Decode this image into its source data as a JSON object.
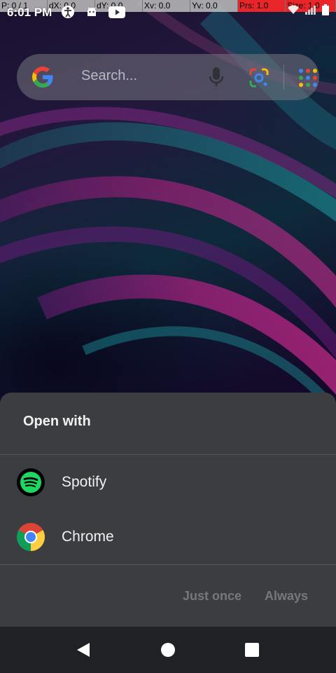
{
  "debug_overlay": {
    "pointer": "P: 0 / 1",
    "dx": "dX: 0.0",
    "dy": "dY: 0.0",
    "xv": "Xv: 0.0",
    "yv": "Yv: 0.0",
    "prs": "Prs: 1.0",
    "size": "Size: 1.0"
  },
  "status_bar": {
    "time": "6:01 PM",
    "icons": [
      "accessibility-icon",
      "android-debug-icon",
      "youtube-icon"
    ],
    "right_icons": [
      "wifi-icon",
      "signal-icon",
      "battery-icon"
    ]
  },
  "search_widget": {
    "placeholder": "Search..."
  },
  "open_with_sheet": {
    "title": "Open with",
    "apps": [
      {
        "label": "Spotify",
        "icon": "spotify-icon"
      },
      {
        "label": "Chrome",
        "icon": "chrome-icon"
      }
    ],
    "just_once_label": "Just once",
    "always_label": "Always"
  },
  "nav_bar": {
    "buttons": [
      "back-icon",
      "home-icon",
      "recents-icon"
    ]
  },
  "colors": {
    "sheet_bg": "#3b3d40",
    "nav_bg": "#202124",
    "spotify_green": "#1ed760",
    "disabled_text": "#75787d"
  }
}
